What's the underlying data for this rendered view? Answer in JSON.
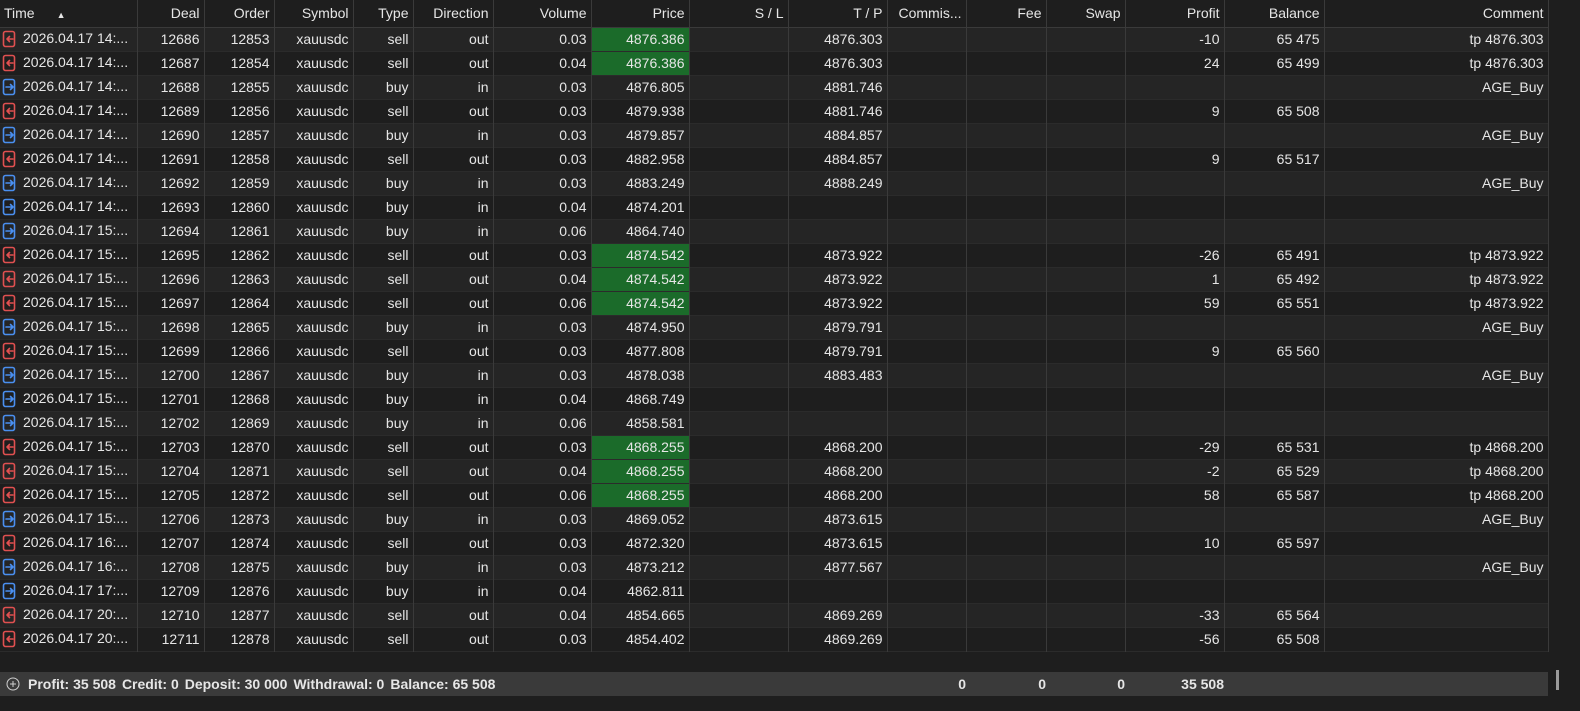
{
  "columns": [
    {
      "key": "time",
      "label": "Time"
    },
    {
      "key": "deal",
      "label": "Deal"
    },
    {
      "key": "order",
      "label": "Order"
    },
    {
      "key": "symbol",
      "label": "Symbol"
    },
    {
      "key": "type",
      "label": "Type"
    },
    {
      "key": "direction",
      "label": "Direction"
    },
    {
      "key": "volume",
      "label": "Volume"
    },
    {
      "key": "price",
      "label": "Price"
    },
    {
      "key": "sl",
      "label": "S / L"
    },
    {
      "key": "tp",
      "label": "T / P"
    },
    {
      "key": "commission",
      "label": "Commis..."
    },
    {
      "key": "fee",
      "label": "Fee"
    },
    {
      "key": "swap",
      "label": "Swap"
    },
    {
      "key": "profit",
      "label": "Profit"
    },
    {
      "key": "balance",
      "label": "Balance"
    },
    {
      "key": "comment",
      "label": "Comment"
    }
  ],
  "sort_indicator": "▲",
  "colors": {
    "sell_icon": "#e05050",
    "buy_icon": "#4a8ff0",
    "highlight": "#1b6b2a"
  },
  "rows": [
    {
      "time": "2026.04.17 14:...",
      "deal": "12686",
      "order": "12853",
      "symbol": "xauusdc",
      "type": "sell",
      "direction": "out",
      "volume": "0.03",
      "price": "4876.386",
      "sl": "",
      "tp": "4876.303",
      "commission": "",
      "fee": "",
      "swap": "",
      "profit": "-10",
      "balance": "65 475",
      "comment": "tp 4876.303",
      "hl": true
    },
    {
      "time": "2026.04.17 14:...",
      "deal": "12687",
      "order": "12854",
      "symbol": "xauusdc",
      "type": "sell",
      "direction": "out",
      "volume": "0.04",
      "price": "4876.386",
      "sl": "",
      "tp": "4876.303",
      "commission": "",
      "fee": "",
      "swap": "",
      "profit": "24",
      "balance": "65 499",
      "comment": "tp 4876.303",
      "hl": true
    },
    {
      "time": "2026.04.17 14:...",
      "deal": "12688",
      "order": "12855",
      "symbol": "xauusdc",
      "type": "buy",
      "direction": "in",
      "volume": "0.03",
      "price": "4876.805",
      "sl": "",
      "tp": "4881.746",
      "commission": "",
      "fee": "",
      "swap": "",
      "profit": "",
      "balance": "",
      "comment": "AGE_Buy",
      "hl": false
    },
    {
      "time": "2026.04.17 14:...",
      "deal": "12689",
      "order": "12856",
      "symbol": "xauusdc",
      "type": "sell",
      "direction": "out",
      "volume": "0.03",
      "price": "4879.938",
      "sl": "",
      "tp": "4881.746",
      "commission": "",
      "fee": "",
      "swap": "",
      "profit": "9",
      "balance": "65 508",
      "comment": "",
      "hl": false
    },
    {
      "time": "2026.04.17 14:...",
      "deal": "12690",
      "order": "12857",
      "symbol": "xauusdc",
      "type": "buy",
      "direction": "in",
      "volume": "0.03",
      "price": "4879.857",
      "sl": "",
      "tp": "4884.857",
      "commission": "",
      "fee": "",
      "swap": "",
      "profit": "",
      "balance": "",
      "comment": "AGE_Buy",
      "hl": false
    },
    {
      "time": "2026.04.17 14:...",
      "deal": "12691",
      "order": "12858",
      "symbol": "xauusdc",
      "type": "sell",
      "direction": "out",
      "volume": "0.03",
      "price": "4882.958",
      "sl": "",
      "tp": "4884.857",
      "commission": "",
      "fee": "",
      "swap": "",
      "profit": "9",
      "balance": "65 517",
      "comment": "",
      "hl": false
    },
    {
      "time": "2026.04.17 14:...",
      "deal": "12692",
      "order": "12859",
      "symbol": "xauusdc",
      "type": "buy",
      "direction": "in",
      "volume": "0.03",
      "price": "4883.249",
      "sl": "",
      "tp": "4888.249",
      "commission": "",
      "fee": "",
      "swap": "",
      "profit": "",
      "balance": "",
      "comment": "AGE_Buy",
      "hl": false
    },
    {
      "time": "2026.04.17 14:...",
      "deal": "12693",
      "order": "12860",
      "symbol": "xauusdc",
      "type": "buy",
      "direction": "in",
      "volume": "0.04",
      "price": "4874.201",
      "sl": "",
      "tp": "",
      "commission": "",
      "fee": "",
      "swap": "",
      "profit": "",
      "balance": "",
      "comment": "",
      "hl": false
    },
    {
      "time": "2026.04.17 15:...",
      "deal": "12694",
      "order": "12861",
      "symbol": "xauusdc",
      "type": "buy",
      "direction": "in",
      "volume": "0.06",
      "price": "4864.740",
      "sl": "",
      "tp": "",
      "commission": "",
      "fee": "",
      "swap": "",
      "profit": "",
      "balance": "",
      "comment": "",
      "hl": false
    },
    {
      "time": "2026.04.17 15:...",
      "deal": "12695",
      "order": "12862",
      "symbol": "xauusdc",
      "type": "sell",
      "direction": "out",
      "volume": "0.03",
      "price": "4874.542",
      "sl": "",
      "tp": "4873.922",
      "commission": "",
      "fee": "",
      "swap": "",
      "profit": "-26",
      "balance": "65 491",
      "comment": "tp 4873.922",
      "hl": true
    },
    {
      "time": "2026.04.17 15:...",
      "deal": "12696",
      "order": "12863",
      "symbol": "xauusdc",
      "type": "sell",
      "direction": "out",
      "volume": "0.04",
      "price": "4874.542",
      "sl": "",
      "tp": "4873.922",
      "commission": "",
      "fee": "",
      "swap": "",
      "profit": "1",
      "balance": "65 492",
      "comment": "tp 4873.922",
      "hl": true
    },
    {
      "time": "2026.04.17 15:...",
      "deal": "12697",
      "order": "12864",
      "symbol": "xauusdc",
      "type": "sell",
      "direction": "out",
      "volume": "0.06",
      "price": "4874.542",
      "sl": "",
      "tp": "4873.922",
      "commission": "",
      "fee": "",
      "swap": "",
      "profit": "59",
      "balance": "65 551",
      "comment": "tp 4873.922",
      "hl": true
    },
    {
      "time": "2026.04.17 15:...",
      "deal": "12698",
      "order": "12865",
      "symbol": "xauusdc",
      "type": "buy",
      "direction": "in",
      "volume": "0.03",
      "price": "4874.950",
      "sl": "",
      "tp": "4879.791",
      "commission": "",
      "fee": "",
      "swap": "",
      "profit": "",
      "balance": "",
      "comment": "AGE_Buy",
      "hl": false
    },
    {
      "time": "2026.04.17 15:...",
      "deal": "12699",
      "order": "12866",
      "symbol": "xauusdc",
      "type": "sell",
      "direction": "out",
      "volume": "0.03",
      "price": "4877.808",
      "sl": "",
      "tp": "4879.791",
      "commission": "",
      "fee": "",
      "swap": "",
      "profit": "9",
      "balance": "65 560",
      "comment": "",
      "hl": false
    },
    {
      "time": "2026.04.17 15:...",
      "deal": "12700",
      "order": "12867",
      "symbol": "xauusdc",
      "type": "buy",
      "direction": "in",
      "volume": "0.03",
      "price": "4878.038",
      "sl": "",
      "tp": "4883.483",
      "commission": "",
      "fee": "",
      "swap": "",
      "profit": "",
      "balance": "",
      "comment": "AGE_Buy",
      "hl": false
    },
    {
      "time": "2026.04.17 15:...",
      "deal": "12701",
      "order": "12868",
      "symbol": "xauusdc",
      "type": "buy",
      "direction": "in",
      "volume": "0.04",
      "price": "4868.749",
      "sl": "",
      "tp": "",
      "commission": "",
      "fee": "",
      "swap": "",
      "profit": "",
      "balance": "",
      "comment": "",
      "hl": false
    },
    {
      "time": "2026.04.17 15:...",
      "deal": "12702",
      "order": "12869",
      "symbol": "xauusdc",
      "type": "buy",
      "direction": "in",
      "volume": "0.06",
      "price": "4858.581",
      "sl": "",
      "tp": "",
      "commission": "",
      "fee": "",
      "swap": "",
      "profit": "",
      "balance": "",
      "comment": "",
      "hl": false
    },
    {
      "time": "2026.04.17 15:...",
      "deal": "12703",
      "order": "12870",
      "symbol": "xauusdc",
      "type": "sell",
      "direction": "out",
      "volume": "0.03",
      "price": "4868.255",
      "sl": "",
      "tp": "4868.200",
      "commission": "",
      "fee": "",
      "swap": "",
      "profit": "-29",
      "balance": "65 531",
      "comment": "tp 4868.200",
      "hl": true
    },
    {
      "time": "2026.04.17 15:...",
      "deal": "12704",
      "order": "12871",
      "symbol": "xauusdc",
      "type": "sell",
      "direction": "out",
      "volume": "0.04",
      "price": "4868.255",
      "sl": "",
      "tp": "4868.200",
      "commission": "",
      "fee": "",
      "swap": "",
      "profit": "-2",
      "balance": "65 529",
      "comment": "tp 4868.200",
      "hl": true
    },
    {
      "time": "2026.04.17 15:...",
      "deal": "12705",
      "order": "12872",
      "symbol": "xauusdc",
      "type": "sell",
      "direction": "out",
      "volume": "0.06",
      "price": "4868.255",
      "sl": "",
      "tp": "4868.200",
      "commission": "",
      "fee": "",
      "swap": "",
      "profit": "58",
      "balance": "65 587",
      "comment": "tp 4868.200",
      "hl": true
    },
    {
      "time": "2026.04.17 15:...",
      "deal": "12706",
      "order": "12873",
      "symbol": "xauusdc",
      "type": "buy",
      "direction": "in",
      "volume": "0.03",
      "price": "4869.052",
      "sl": "",
      "tp": "4873.615",
      "commission": "",
      "fee": "",
      "swap": "",
      "profit": "",
      "balance": "",
      "comment": "AGE_Buy",
      "hl": false
    },
    {
      "time": "2026.04.17 16:...",
      "deal": "12707",
      "order": "12874",
      "symbol": "xauusdc",
      "type": "sell",
      "direction": "out",
      "volume": "0.03",
      "price": "4872.320",
      "sl": "",
      "tp": "4873.615",
      "commission": "",
      "fee": "",
      "swap": "",
      "profit": "10",
      "balance": "65 597",
      "comment": "",
      "hl": false
    },
    {
      "time": "2026.04.17 16:...",
      "deal": "12708",
      "order": "12875",
      "symbol": "xauusdc",
      "type": "buy",
      "direction": "in",
      "volume": "0.03",
      "price": "4873.212",
      "sl": "",
      "tp": "4877.567",
      "commission": "",
      "fee": "",
      "swap": "",
      "profit": "",
      "balance": "",
      "comment": "AGE_Buy",
      "hl": false
    },
    {
      "time": "2026.04.17 17:...",
      "deal": "12709",
      "order": "12876",
      "symbol": "xauusdc",
      "type": "buy",
      "direction": "in",
      "volume": "0.04",
      "price": "4862.811",
      "sl": "",
      "tp": "",
      "commission": "",
      "fee": "",
      "swap": "",
      "profit": "",
      "balance": "",
      "comment": "",
      "hl": false
    },
    {
      "time": "2026.04.17 20:...",
      "deal": "12710",
      "order": "12877",
      "symbol": "xauusdc",
      "type": "sell",
      "direction": "out",
      "volume": "0.04",
      "price": "4854.665",
      "sl": "",
      "tp": "4869.269",
      "commission": "",
      "fee": "",
      "swap": "",
      "profit": "-33",
      "balance": "65 564",
      "comment": "",
      "hl": false
    },
    {
      "time": "2026.04.17 20:...",
      "deal": "12711",
      "order": "12878",
      "symbol": "xauusdc",
      "type": "sell",
      "direction": "out",
      "volume": "0.03",
      "price": "4854.402",
      "sl": "",
      "tp": "4869.269",
      "commission": "",
      "fee": "",
      "swap": "",
      "profit": "-56",
      "balance": "65 508",
      "comment": "",
      "hl": false
    }
  ],
  "footer": {
    "profit": "Profit: 35 508",
    "credit": "Credit: 0",
    "deposit": "Deposit: 30 000",
    "withdrawal": "Withdrawal: 0",
    "balance": "Balance: 65 508",
    "commission_total": "0",
    "fee_total": "0",
    "swap_total": "0",
    "profit_total": "35 508"
  }
}
